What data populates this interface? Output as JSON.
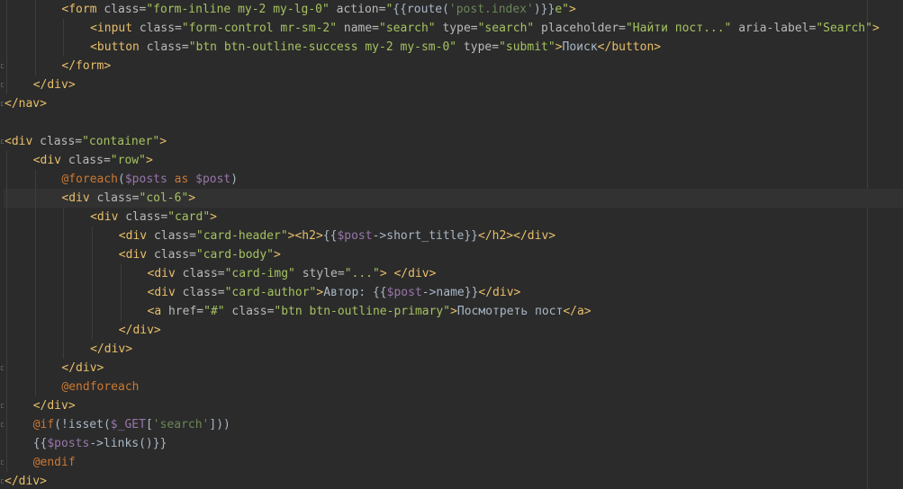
{
  "editor": {
    "colors": {
      "background": "#2b2b2b",
      "tag": "#e8bf6a",
      "attribute": "#bababa",
      "string": "#a5c261",
      "directive": "#cc7832",
      "variable": "#9876aa",
      "text": "#a9b7c6"
    },
    "lines": [
      {
        "indent": 2,
        "tokens": [
          [
            "tag",
            "<form "
          ],
          [
            "attr",
            "class="
          ],
          [
            "str",
            "\"form-inline my-2 my-lg-0\""
          ],
          [
            "attr",
            " action="
          ],
          [
            "str",
            "\""
          ],
          [
            "plain",
            "{{route("
          ],
          [
            "sq",
            "'post.index'"
          ],
          [
            "plain",
            ")}}"
          ],
          [
            "str",
            "e\""
          ],
          [
            "tag",
            ">"
          ]
        ]
      },
      {
        "indent": 3,
        "tokens": [
          [
            "tag",
            "<input "
          ],
          [
            "attr",
            "class="
          ],
          [
            "str",
            "\"form-control mr-sm-2\""
          ],
          [
            "attr",
            " name="
          ],
          [
            "str",
            "\"search\""
          ],
          [
            "attr",
            " type="
          ],
          [
            "str",
            "\"search\""
          ],
          [
            "attr",
            " placeholder="
          ],
          [
            "str",
            "\"Найти пост...\""
          ],
          [
            "attr",
            " aria-label="
          ],
          [
            "str",
            "\"Search\""
          ],
          [
            "tag",
            ">"
          ]
        ]
      },
      {
        "indent": 3,
        "tokens": [
          [
            "tag",
            "<button "
          ],
          [
            "attr",
            "class="
          ],
          [
            "str",
            "\"btn btn-outline-success my-2 my-sm-0\""
          ],
          [
            "attr",
            " type="
          ],
          [
            "str",
            "\"submit\""
          ],
          [
            "tag",
            ">"
          ],
          [
            "plain",
            "Поиск"
          ],
          [
            "tag",
            "</button>"
          ]
        ]
      },
      {
        "indent": 2,
        "tokens": [
          [
            "tag",
            "</form>"
          ]
        ]
      },
      {
        "indent": 1,
        "tokens": [
          [
            "tag",
            "</div>"
          ]
        ]
      },
      {
        "indent": 0,
        "tokens": [
          [
            "tag",
            "</nav>"
          ]
        ]
      },
      {
        "indent": 0,
        "tokens": []
      },
      {
        "indent": 0,
        "tokens": [
          [
            "tag",
            "<div "
          ],
          [
            "attr",
            "class="
          ],
          [
            "str",
            "\"container\""
          ],
          [
            "tag",
            ">"
          ]
        ]
      },
      {
        "indent": 1,
        "tokens": [
          [
            "tag",
            "<div "
          ],
          [
            "attr",
            "class="
          ],
          [
            "str",
            "\"row\""
          ],
          [
            "tag",
            ">"
          ]
        ]
      },
      {
        "indent": 2,
        "tokens": [
          [
            "dir",
            "@foreach"
          ],
          [
            "plain",
            "("
          ],
          [
            "var",
            "$posts"
          ],
          [
            "kw",
            " as "
          ],
          [
            "var",
            "$post"
          ],
          [
            "plain",
            ")"
          ]
        ]
      },
      {
        "indent": 2,
        "current": true,
        "tokens": [
          [
            "tag",
            "<div "
          ],
          [
            "attr",
            "class="
          ],
          [
            "str",
            "\"col-6\""
          ],
          [
            "tag",
            ">"
          ]
        ]
      },
      {
        "indent": 3,
        "tokens": [
          [
            "tag",
            "<div "
          ],
          [
            "attr",
            "class="
          ],
          [
            "str",
            "\"card\""
          ],
          [
            "tag",
            ">"
          ]
        ]
      },
      {
        "indent": 4,
        "tokens": [
          [
            "tag",
            "<div "
          ],
          [
            "attr",
            "class="
          ],
          [
            "str",
            "\"card-header\""
          ],
          [
            "tag",
            "><h2>"
          ],
          [
            "plain",
            "{{"
          ],
          [
            "var",
            "$post"
          ],
          [
            "plain",
            "->short_title}}"
          ],
          [
            "tag",
            "</h2></div>"
          ]
        ]
      },
      {
        "indent": 4,
        "tokens": [
          [
            "tag",
            "<div "
          ],
          [
            "attr",
            "class="
          ],
          [
            "str",
            "\"card-body\""
          ],
          [
            "tag",
            ">"
          ]
        ]
      },
      {
        "indent": 5,
        "tokens": [
          [
            "tag",
            "<div "
          ],
          [
            "attr",
            "class="
          ],
          [
            "str",
            "\"card-img\""
          ],
          [
            "attr",
            " style="
          ],
          [
            "str",
            "\"...\""
          ],
          [
            "tag",
            "> </div>"
          ]
        ]
      },
      {
        "indent": 5,
        "tokens": [
          [
            "tag",
            "<div "
          ],
          [
            "attr",
            "class="
          ],
          [
            "str",
            "\"card-author\""
          ],
          [
            "tag",
            ">"
          ],
          [
            "plain",
            "Автор: {{"
          ],
          [
            "var",
            "$post"
          ],
          [
            "plain",
            "->name}}"
          ],
          [
            "tag",
            "</div>"
          ]
        ]
      },
      {
        "indent": 5,
        "tokens": [
          [
            "tag",
            "<a "
          ],
          [
            "attr",
            "href="
          ],
          [
            "str",
            "\"#\""
          ],
          [
            "attr",
            " class="
          ],
          [
            "str",
            "\"btn btn-outline-primary\""
          ],
          [
            "tag",
            ">"
          ],
          [
            "plain",
            "Посмотреть пост"
          ],
          [
            "tag",
            "</a>"
          ]
        ]
      },
      {
        "indent": 4,
        "tokens": [
          [
            "tag",
            "</div>"
          ]
        ]
      },
      {
        "indent": 3,
        "tokens": [
          [
            "tag",
            "</div>"
          ]
        ]
      },
      {
        "indent": 2,
        "tokens": [
          [
            "tag",
            "</div>"
          ]
        ]
      },
      {
        "indent": 2,
        "tokens": [
          [
            "dir",
            "@endforeach"
          ]
        ]
      },
      {
        "indent": 1,
        "tokens": [
          [
            "tag",
            "</div>"
          ]
        ]
      },
      {
        "indent": 1,
        "tokens": [
          [
            "dir",
            "@if"
          ],
          [
            "plain",
            "(!isset("
          ],
          [
            "var",
            "$_GET"
          ],
          [
            "plain",
            "["
          ],
          [
            "sq",
            "'search'"
          ],
          [
            "plain",
            "]))"
          ]
        ]
      },
      {
        "indent": 1,
        "tokens": [
          [
            "plain",
            "{{"
          ],
          [
            "var",
            "$posts"
          ],
          [
            "plain",
            "->links()}}"
          ]
        ]
      },
      {
        "indent": 1,
        "tokens": [
          [
            "dir",
            "@endif"
          ]
        ]
      },
      {
        "indent": 0,
        "tokens": [
          [
            "tag",
            "</div>"
          ]
        ]
      }
    ]
  }
}
